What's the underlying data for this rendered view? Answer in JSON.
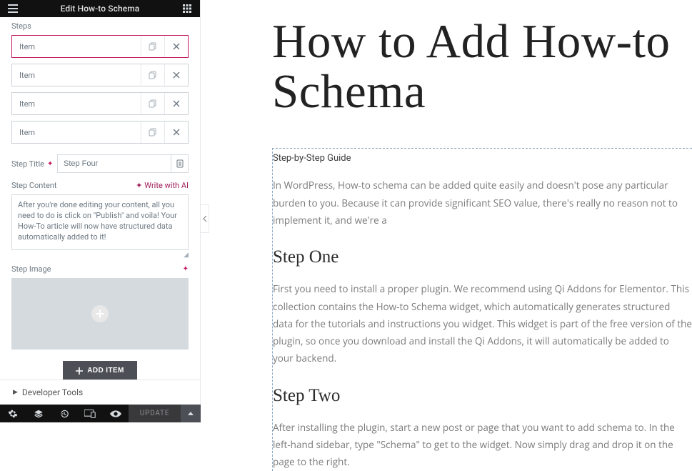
{
  "header": {
    "title": "Edit How-to Schema"
  },
  "steps_section_label": "Steps",
  "items": [
    {
      "label": "Item",
      "selected": true
    },
    {
      "label": "Item",
      "selected": false
    },
    {
      "label": "Item",
      "selected": false
    },
    {
      "label": "Item",
      "selected": false
    }
  ],
  "step_title_field": {
    "label": "Step Title",
    "value": "Step Four"
  },
  "step_content_field": {
    "label": "Step Content",
    "write_ai_label": "Write with AI",
    "value": "After you're done editing your content, all you need to do is click on \"Publish\" and voila! Your How-To article will now have structured data automatically added to it!"
  },
  "step_image_field": {
    "label": "Step Image"
  },
  "add_item_label": "ADD ITEM",
  "developer_tools_label": "Developer Tools",
  "update_label": "UPDATE",
  "preview": {
    "title": "How to Add How-to Schema",
    "subtitle": "Step-by-Step Guide",
    "intro": "In WordPress, How-to schema can be added quite easily and doesn't pose any particular burden to you. Because it can provide significant SEO value, there's really no reason not to implement it, and we're a",
    "steps": [
      {
        "title": "Step One",
        "body": "First you need to install a proper plugin. We recommend using Qi Addons for Elementor. This collection contains the How-to Schema widget, which automatically generates structured data for the tutorials and instructions you widget. This widget is part of the free version of the plugin, so once you download and install the Qi Addons, it will automatically be added to your backend."
      },
      {
        "title": "Step Two",
        "body": "After installing the plugin, start a new post or page that you want to add schema to. In the left-hand sidebar, type \"Schema\" to get to the widget. Now simply drag and drop it on the page to the right."
      }
    ]
  }
}
